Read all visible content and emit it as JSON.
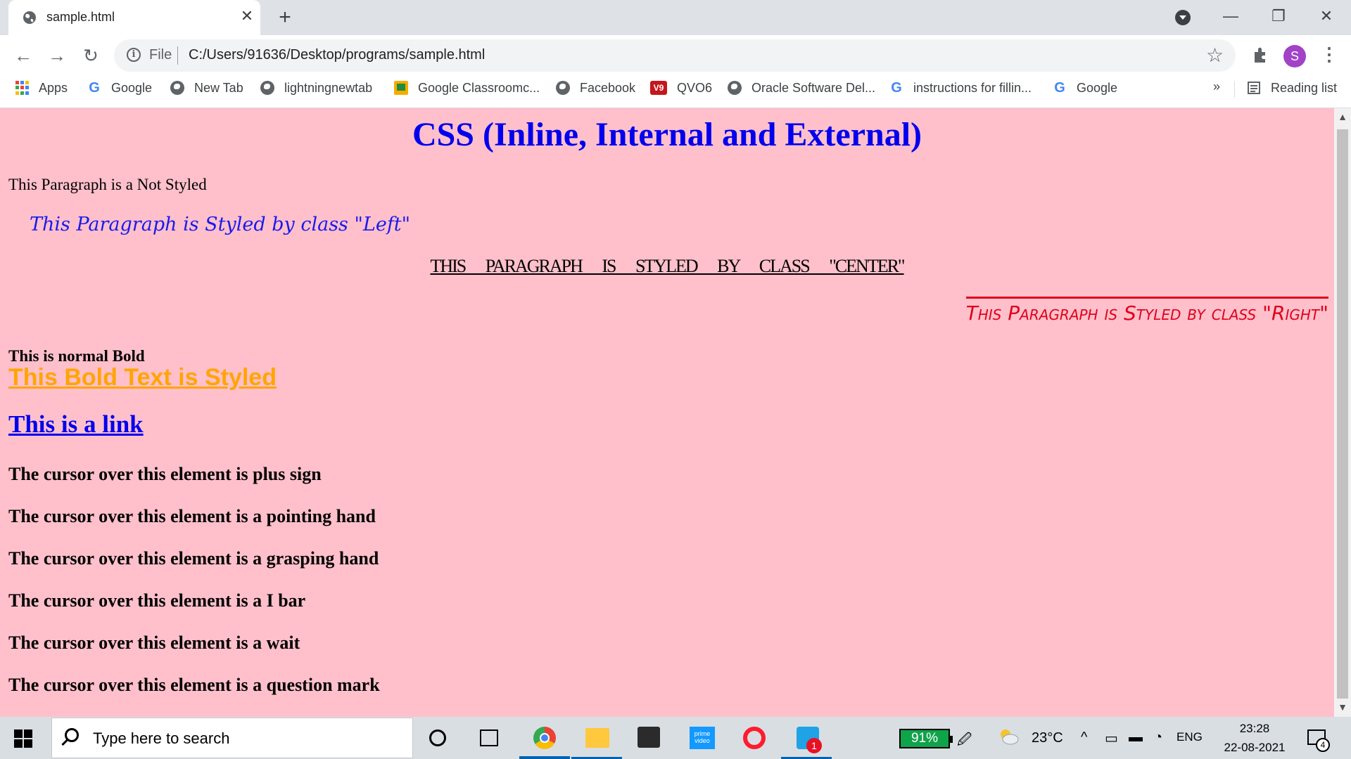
{
  "browser": {
    "tab": {
      "title": "sample.html"
    },
    "window_controls": {
      "minimize": "—",
      "restore": "❐",
      "close": "✕"
    },
    "omnibox": {
      "scheme": "File",
      "url": "C:/Users/91636/Desktop/programs/sample.html"
    },
    "profile_initial": "S",
    "bookmarks": [
      {
        "label": "Apps",
        "icon": "apps-grid-icon"
      },
      {
        "label": "Google",
        "icon": "google-icon"
      },
      {
        "label": "New Tab",
        "icon": "globe-icon"
      },
      {
        "label": "lightningnewtab",
        "icon": "globe-icon"
      },
      {
        "label": "Google Classroomc...",
        "icon": "classroom-icon"
      },
      {
        "label": "Facebook",
        "icon": "globe-icon"
      },
      {
        "label": "QVO6",
        "icon": "v9-icon"
      },
      {
        "label": "Oracle Software Del...",
        "icon": "globe-icon"
      },
      {
        "label": "instructions for fillin...",
        "icon": "google-icon"
      },
      {
        "label": "Google",
        "icon": "google-icon"
      }
    ],
    "bookmarks_overflow": "»",
    "reading_list": "Reading list"
  },
  "page": {
    "title": "CSS (Inline, Internal and External)",
    "p_plain": "This Paragraph is a Not Styled",
    "p_left": "This Paragraph is Styled by class \"Left\"",
    "p_center": "This Paragraph is Styled by class \"Center\"",
    "p_right": "This Paragraph is Styled by class \"Right\"",
    "bold_normal": "This is normal Bold",
    "bold_styled": "This Bold Text is Styled",
    "link": "This is a link",
    "cursors": [
      "The cursor over this element is plus sign",
      "The cursor over this element is a pointing hand",
      "The cursor over this element is a grasping hand",
      "The cursor over this element is a I bar",
      "The cursor over this element is a wait",
      "The cursor over this element is a question mark"
    ]
  },
  "taskbar": {
    "search_placeholder": "Type here to search",
    "prime_label": "prime video",
    "whatsapp_badge": "1",
    "battery": "91%",
    "temperature": "23°C",
    "language": "ENG",
    "time": "23:28",
    "date": "22-08-2021",
    "notification_count": "4"
  },
  "colors": {
    "page_bg": "#ffc0cb",
    "title": "#0000ee",
    "left": "#1a1aee",
    "right": "#e0001a",
    "styled_bold": "#ffa500",
    "link": "#0000ee"
  }
}
